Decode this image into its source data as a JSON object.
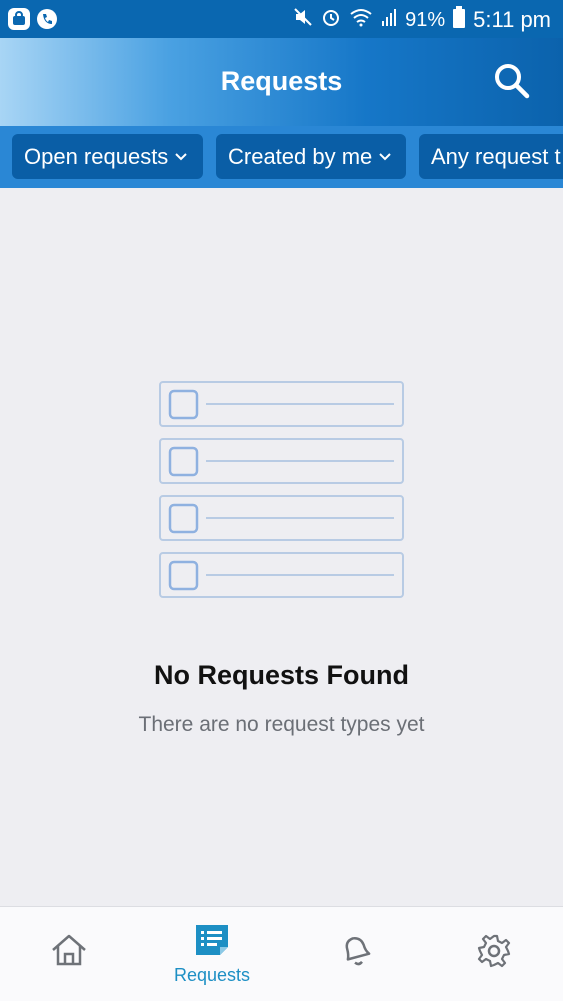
{
  "status_bar": {
    "battery": "91%",
    "time": "5:11 pm",
    "icons": [
      "app-badge-icon",
      "phone-icon",
      "mute-icon",
      "alarm-icon",
      "wifi-icon",
      "signal-icon",
      "battery-icon"
    ]
  },
  "header": {
    "title": "Requests",
    "search_icon": "search-icon"
  },
  "filters": [
    {
      "label": "Open requests"
    },
    {
      "label": "Created by me"
    },
    {
      "label": "Any request t"
    }
  ],
  "empty_state": {
    "title": "No Requests Found",
    "subtitle": "There are no request types yet"
  },
  "bottom_nav": {
    "items": [
      {
        "icon": "home-icon",
        "label": ""
      },
      {
        "icon": "requests-icon",
        "label": "Requests",
        "active": true
      },
      {
        "icon": "bell-icon",
        "label": ""
      },
      {
        "icon": "gear-icon",
        "label": ""
      }
    ],
    "active_color": "#1d8fc4"
  }
}
